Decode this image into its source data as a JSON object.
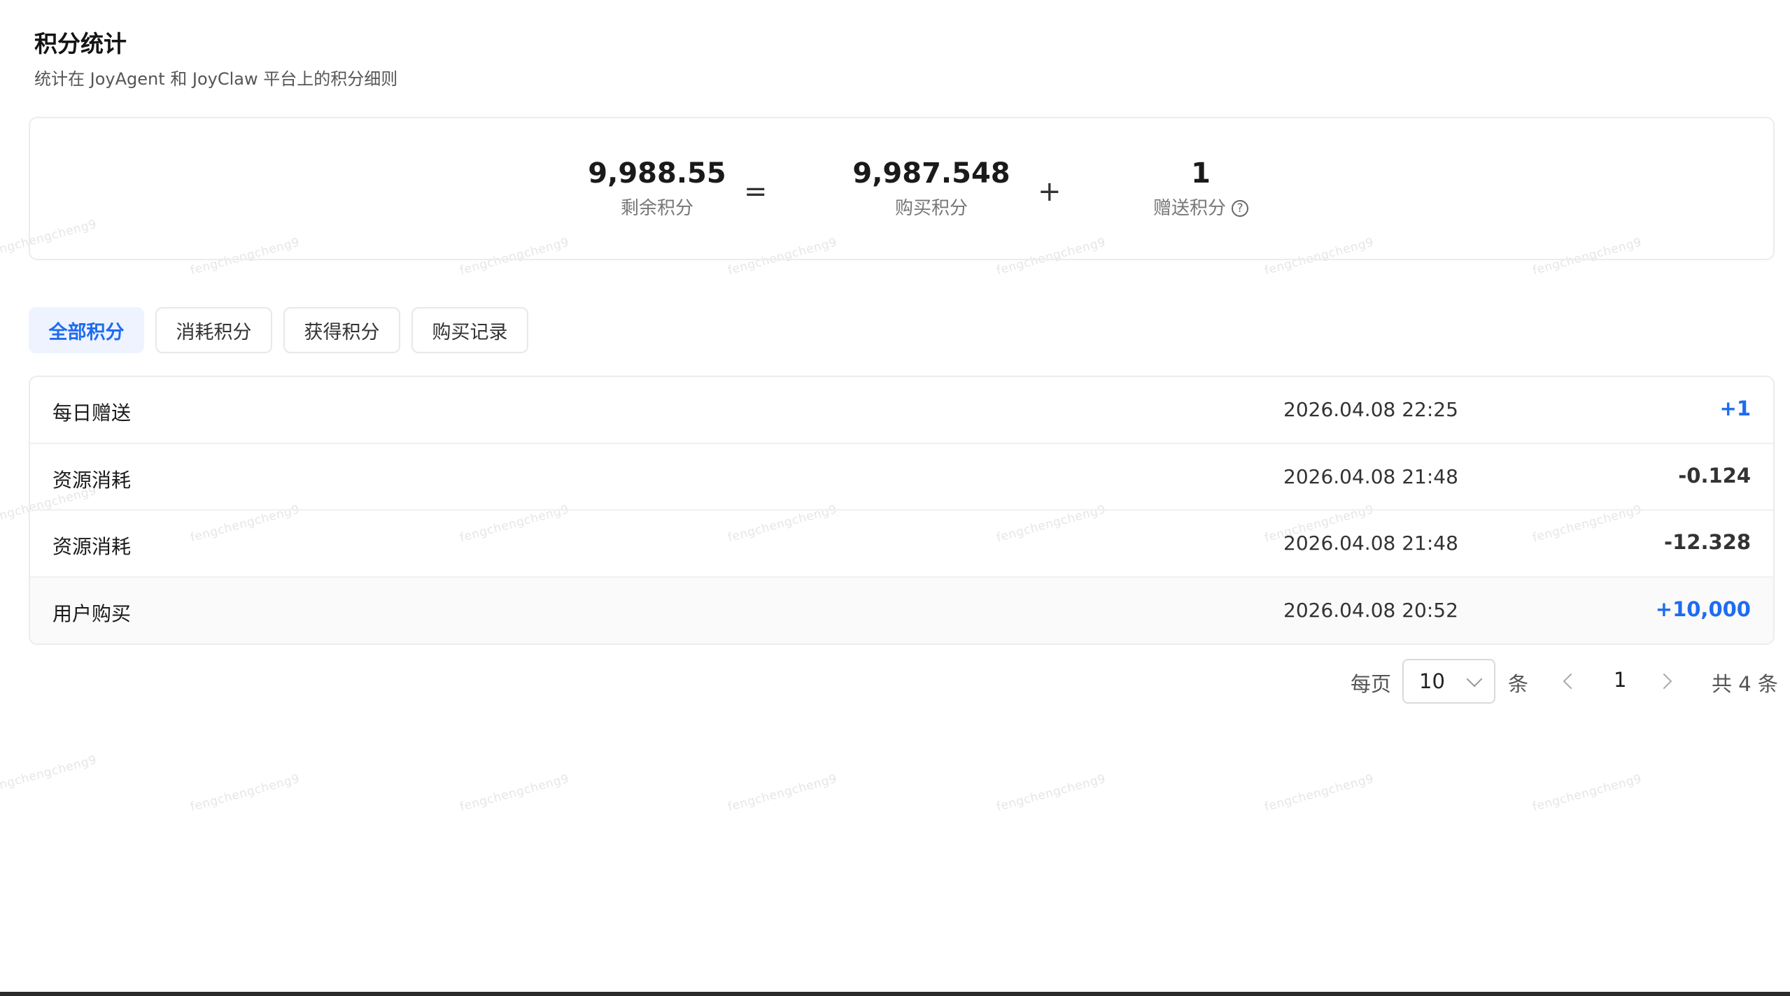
{
  "header": {
    "title": "积分统计",
    "subtitle": "统计在 JoyAgent 和 JoyClaw 平台上的积分细则"
  },
  "summary": {
    "remaining": {
      "value": "9,988.55",
      "label": "剩余积分"
    },
    "equals": "=",
    "purchased": {
      "value": "9,987.548",
      "label": "购买积分"
    },
    "plus": "+",
    "gifted": {
      "value": "1",
      "label": "赠送积分",
      "icon": "help-circle-icon"
    }
  },
  "tabs": [
    {
      "label": "全部积分",
      "active": true
    },
    {
      "label": "消耗积分",
      "active": false
    },
    {
      "label": "获得积分",
      "active": false
    },
    {
      "label": "购买记录",
      "active": false
    }
  ],
  "records": [
    {
      "name": "每日赠送",
      "time": "2026.04.08 22:25",
      "amount": "+1",
      "positive": true
    },
    {
      "name": "资源消耗",
      "time": "2026.04.08 21:48",
      "amount": "-0.124",
      "positive": false
    },
    {
      "name": "资源消耗",
      "time": "2026.04.08 21:48",
      "amount": "-12.328",
      "positive": false
    },
    {
      "name": "用户购买",
      "time": "2026.04.08 20:52",
      "amount": "+10,000",
      "positive": true
    }
  ],
  "pagination": {
    "per_page_label": "每页",
    "per_page_value": "10",
    "unit": "条",
    "current_page": "1",
    "total": "共 4 条"
  },
  "watermark": "fengchengcheng9",
  "colors": {
    "accent": "#1e6cf0",
    "active_tab_bg": "#eef3ff"
  }
}
